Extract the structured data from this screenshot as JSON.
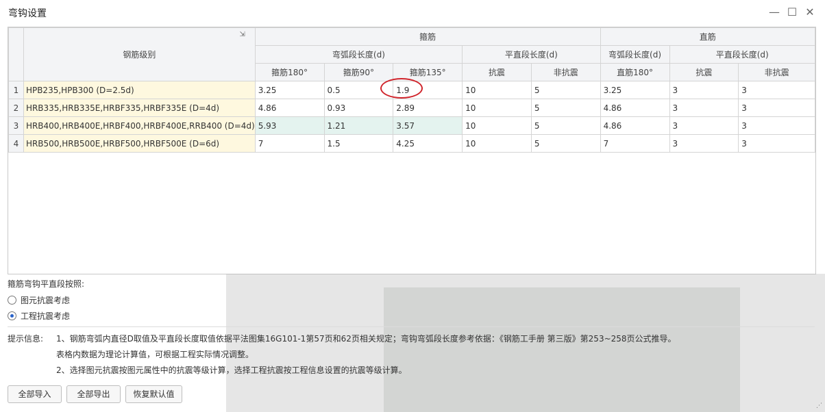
{
  "window": {
    "title": "弯钩设置",
    "minimize_glyph": "—",
    "maximize_glyph": "☐",
    "close_glyph": "✕"
  },
  "table": {
    "header": {
      "grade": "钢筋级别",
      "group_stirrup": "箍筋",
      "group_straight": "直筋",
      "arc_length": "弯弧段长度(d)",
      "flat_length": "平直段长度(d)",
      "straight_arc_length": "弯弧段长度(d)",
      "straight_flat_length": "平直段长度(d)",
      "leaf": [
        "箍筋180°",
        "箍筋90°",
        "箍筋135°",
        "抗震",
        "非抗震",
        "直筋180°",
        "抗震",
        "非抗震"
      ]
    },
    "rows": [
      {
        "n": "1",
        "grade": "HPB235,HPB300 (D=2.5d)",
        "cells": [
          "3.25",
          "0.5",
          "1.9",
          "10",
          "5",
          "3.25",
          "3",
          "3"
        ]
      },
      {
        "n": "2",
        "grade": "HRB335,HRB335E,HRBF335,HRBF335E (D=4d)",
        "cells": [
          "4.86",
          "0.93",
          "2.89",
          "10",
          "5",
          "4.86",
          "3",
          "3"
        ]
      },
      {
        "n": "3",
        "grade": "HRB400,HRB400E,HRBF400,HRBF400E,RRB400 (D=4d)",
        "cells": [
          "5.93",
          "1.21",
          "3.57",
          "10",
          "5",
          "4.86",
          "3",
          "3"
        ]
      },
      {
        "n": "4",
        "grade": "HRB500,HRB500E,HRBF500,HRBF500E (D=6d)",
        "cells": [
          "7",
          "1.5",
          "4.25",
          "10",
          "5",
          "7",
          "3",
          "3"
        ]
      }
    ]
  },
  "options": {
    "label": "箍筋弯钩平直段按照:",
    "radio1": "图元抗震考虑",
    "radio2": "工程抗震考虑",
    "selected": "工程抗震考虑"
  },
  "tips": {
    "label": "提示信息:",
    "line1": "1、钢筋弯弧内直径D取值及平直段长度取值依据平法图集16G101-1第57页和62页相关规定；弯钩弯弧段长度参考依据：《钢筋工手册  第三版》第253~258页公式推导。",
    "line2": "表格内数据为理论计算值，可根据工程实际情况调整。",
    "line3": "2、选择图元抗震按图元属性中的抗震等级计算，选择工程抗震按工程信息设置的抗震等级计算。"
  },
  "buttons": {
    "import_all": "全部导入",
    "export_all": "全部导出",
    "restore_default": "恢复默认值"
  },
  "colors": {
    "grade_bg": "#fef8df",
    "highlight_row_bg": "#e4f3ef",
    "annotation_circle": "#d0242b",
    "radio_selected": "#2a63c9"
  }
}
